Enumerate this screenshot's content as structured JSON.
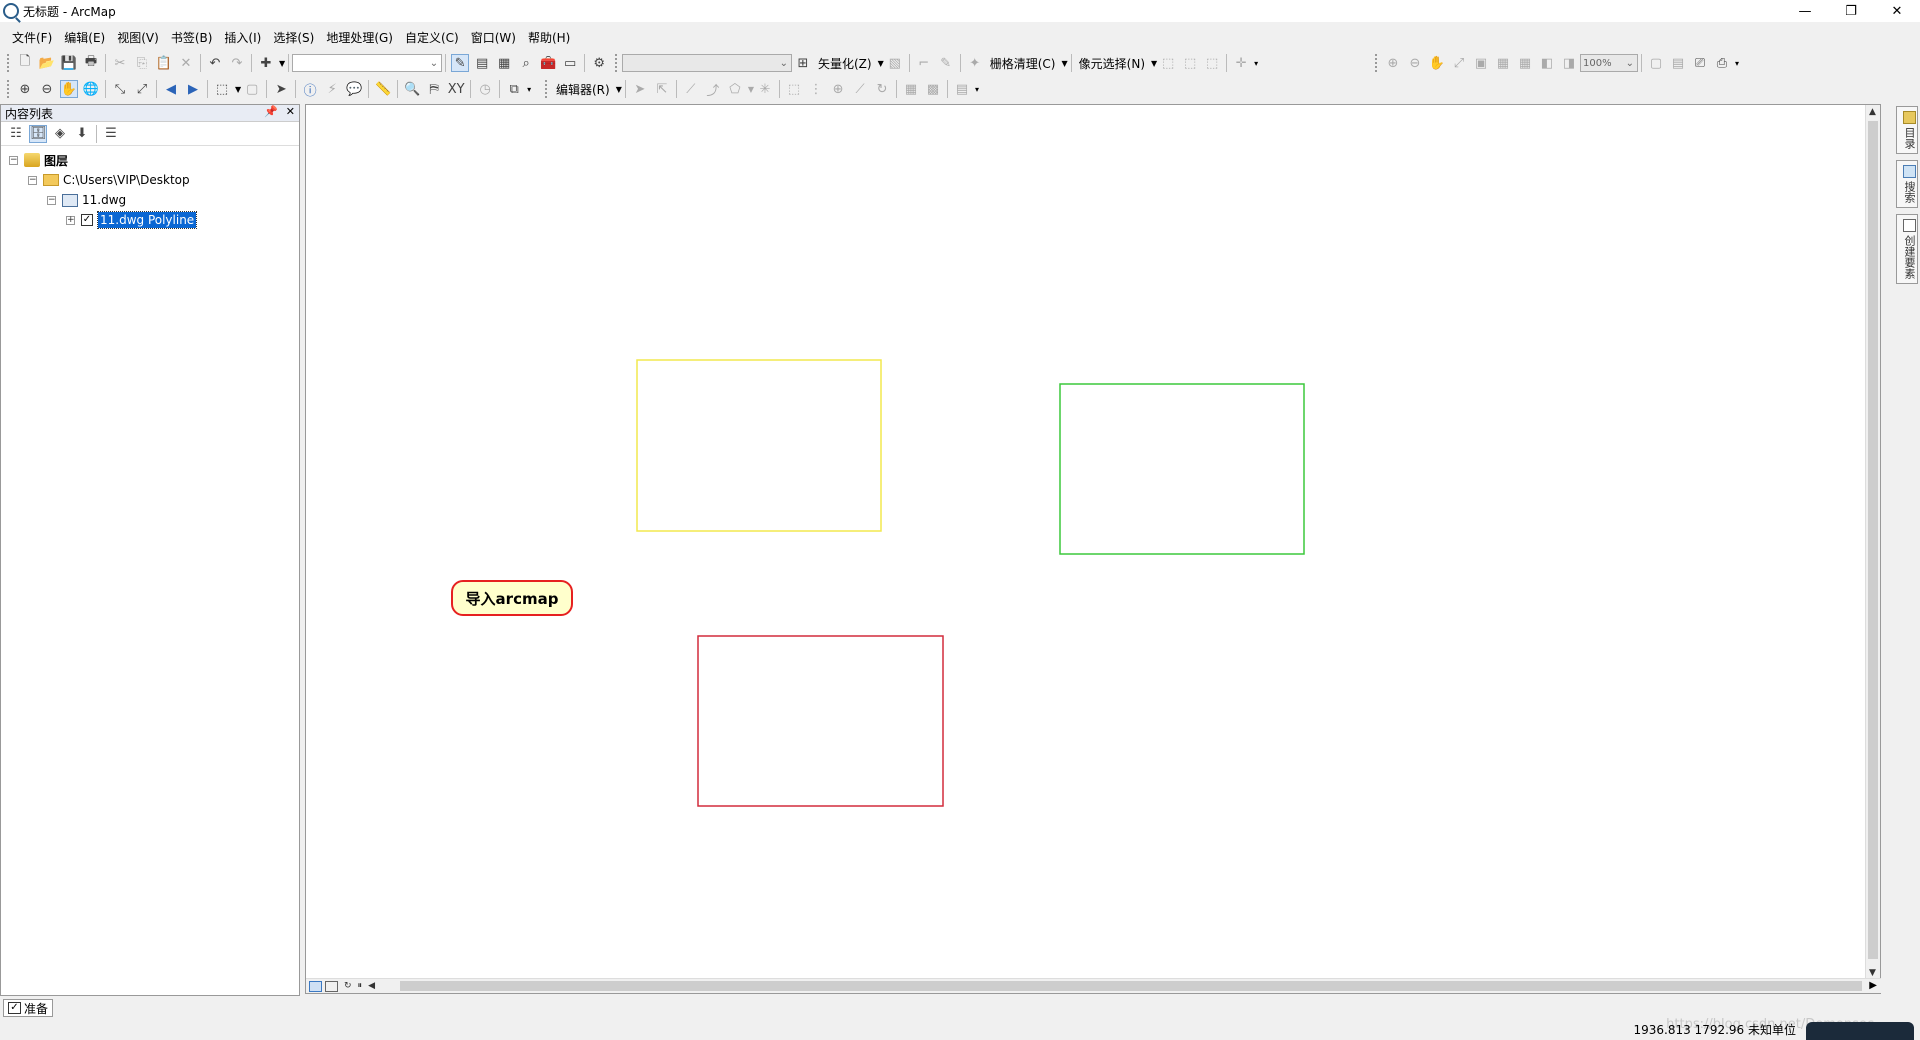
{
  "window": {
    "title": "无标题 - ArcMap",
    "minimize": "—",
    "restore": "❐",
    "close": "✕"
  },
  "menu": [
    "文件(F)",
    "编辑(E)",
    "视图(V)",
    "书签(B)",
    "插入(I)",
    "选择(S)",
    "地理处理(G)",
    "自定义(C)",
    "窗口(W)",
    "帮助(H)"
  ],
  "toolbar": {
    "vectorize": "矢量化(Z)",
    "raster_cleanup": "栅格清理(C)",
    "cell_select": "像元选择(N)",
    "zoom_percent": "100%",
    "editor": "编辑器(R)"
  },
  "toc": {
    "title": "内容列表",
    "root": "图层",
    "folder": "C:\\Users\\VIP\\Desktop",
    "dataset": "11.dwg",
    "layer": "11.dwg Polyline",
    "layer_checked": "✓",
    "expander_minus": "−",
    "expander_plus": "+"
  },
  "map": {
    "callout": "导入arcmap",
    "rects": [
      {
        "name": "yellow-rectangle",
        "color": "#f2e94e"
      },
      {
        "name": "green-rectangle",
        "color": "#3cc83c"
      },
      {
        "name": "red-rectangle",
        "color": "#d22c3c"
      }
    ]
  },
  "right_dock": [
    "目录",
    "搜索",
    "创建要素"
  ],
  "status": {
    "ready": "准备",
    "coordinates": "1936.813  1792.96 未知单位",
    "watermark": "https://blog.csdn.net/Demonsec"
  }
}
